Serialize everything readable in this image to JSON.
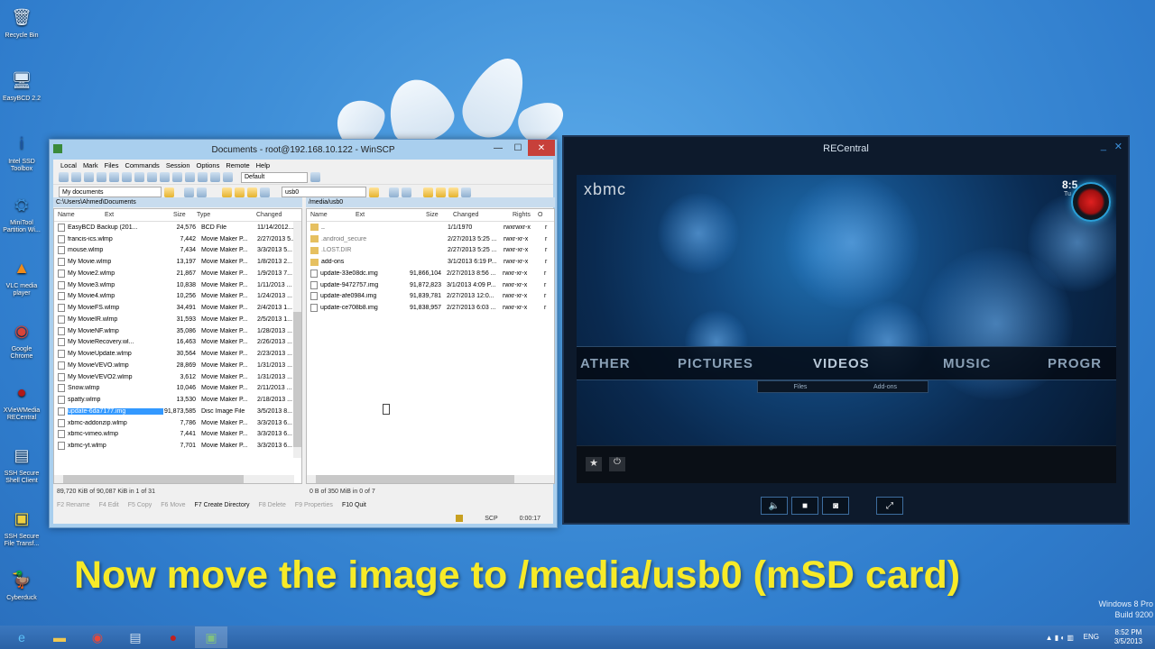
{
  "desktop": {
    "icons": [
      {
        "label": "Recycle Bin",
        "glyph": "🗑",
        "color": "#d8e8f8"
      },
      {
        "label": "EasyBCD 2.2",
        "glyph": "🖥",
        "color": "#d8e8f8"
      },
      {
        "label": "Intel SSD Toolbox",
        "glyph": "i",
        "color": "#1d57a8"
      },
      {
        "label": "MiniTool Partition Wi...",
        "glyph": "⛭",
        "color": "#3a8fd8"
      },
      {
        "label": "VLC media player",
        "glyph": "▲",
        "color": "#f08a1a"
      },
      {
        "label": "Google Chrome",
        "glyph": "◉",
        "color": "#d8443a"
      },
      {
        "label": "XVieWMedia RECentral",
        "glyph": "●",
        "color": "#b01818"
      },
      {
        "label": "SSH Secure Shell Client",
        "glyph": "▤",
        "color": "#d8e8f8"
      },
      {
        "label": "SSH Secure File Transf...",
        "glyph": "▣",
        "color": "#f0d040"
      },
      {
        "label": "Cyberduck",
        "glyph": "🦆",
        "color": "#f6c01e"
      }
    ],
    "watermark": {
      "line1": "Windows 8 Pro",
      "line2": "Build 9200"
    }
  },
  "winscp": {
    "title": "Documents - root@192.168.10.122 - WinSCP",
    "menu": [
      "Local",
      "Mark",
      "Files",
      "Commands",
      "Session",
      "Options",
      "Remote",
      "Help"
    ],
    "profile": "Default",
    "left": {
      "location": "My documents",
      "path": "C:\\Users\\Ahmed\\Documents",
      "columns": [
        "Name",
        "Ext",
        "Size",
        "Type",
        "Changed"
      ],
      "rows": [
        {
          "name": "EasyBCD Backup (201...",
          "size": "24,576",
          "type": "BCD File",
          "changed": "11/14/2012..."
        },
        {
          "name": "francis-ics.wlmp",
          "size": "7,442",
          "type": "Movie Maker P...",
          "changed": "2/27/2013 5..."
        },
        {
          "name": "mouse.wlmp",
          "size": "7,434",
          "type": "Movie Maker P...",
          "changed": "3/3/2013 5..."
        },
        {
          "name": "My Movie.wlmp",
          "size": "13,197",
          "type": "Movie Maker P...",
          "changed": "1/8/2013 2..."
        },
        {
          "name": "My Movie2.wlmp",
          "size": "21,867",
          "type": "Movie Maker P...",
          "changed": "1/9/2013 7..."
        },
        {
          "name": "My Movie3.wlmp",
          "size": "10,838",
          "type": "Movie Maker P...",
          "changed": "1/11/2013 ..."
        },
        {
          "name": "My Movie4.wlmp",
          "size": "10,256",
          "type": "Movie Maker P...",
          "changed": "1/24/2013 ..."
        },
        {
          "name": "My MovieFS.wlmp",
          "size": "34,491",
          "type": "Movie Maker P...",
          "changed": "2/4/2013 1..."
        },
        {
          "name": "My MovieIR.wlmp",
          "size": "31,593",
          "type": "Movie Maker P...",
          "changed": "2/5/2013 1..."
        },
        {
          "name": "My MovieNF.wlmp",
          "size": "35,086",
          "type": "Movie Maker P...",
          "changed": "1/28/2013 ..."
        },
        {
          "name": "My MovieRecovery.wl...",
          "size": "16,463",
          "type": "Movie Maker P...",
          "changed": "2/26/2013 ..."
        },
        {
          "name": "My MovieUpdate.wlmp",
          "size": "30,564",
          "type": "Movie Maker P...",
          "changed": "2/23/2013 ..."
        },
        {
          "name": "My MovieVEVO.wlmp",
          "size": "28,869",
          "type": "Movie Maker P...",
          "changed": "1/31/2013 ..."
        },
        {
          "name": "My MovieVEVO2.wlmp",
          "size": "3,612",
          "type": "Movie Maker P...",
          "changed": "1/31/2013 ..."
        },
        {
          "name": "Snow.wlmp",
          "size": "10,046",
          "type": "Movie Maker P...",
          "changed": "2/11/2013 ..."
        },
        {
          "name": "spatty.wlmp",
          "size": "13,530",
          "type": "Movie Maker P...",
          "changed": "2/18/2013 ..."
        },
        {
          "name": "update-6da7177.img",
          "size": "91,873,585",
          "type": "Disc Image File",
          "changed": "3/5/2013 8..."
        },
        {
          "name": "xbmc-addonzip.wlmp",
          "size": "7,786",
          "type": "Movie Maker P...",
          "changed": "3/3/2013 6..."
        },
        {
          "name": "xbmc-vimeo.wlmp",
          "size": "7,441",
          "type": "Movie Maker P...",
          "changed": "3/3/2013 6..."
        },
        {
          "name": "xbmc-yt.wlmp",
          "size": "7,701",
          "type": "Movie Maker P...",
          "changed": "3/3/2013 6..."
        }
      ],
      "selected_index": 16,
      "status": "89,720 KiB of 90,087 KiB in 1 of 31"
    },
    "right": {
      "location": "usb0",
      "path": "/media/usb0",
      "columns": [
        "Name",
        "Ext",
        "Size",
        "Changed",
        "Rights",
        "O"
      ],
      "rows": [
        {
          "name": "..",
          "size": "",
          "changed": "1/1/1970",
          "rights": "rwxrwxr-x",
          "o": "r",
          "folder": true
        },
        {
          "name": ".android_secure",
          "size": "",
          "changed": "2/27/2013 5:25 ...",
          "rights": "rwxr-xr-x",
          "o": "r",
          "folder": true
        },
        {
          "name": ".LOST.DIR",
          "size": "",
          "changed": "2/27/2013 5:25 ...",
          "rights": "rwxr-xr-x",
          "o": "r",
          "folder": true
        },
        {
          "name": "add-ons",
          "size": "",
          "changed": "3/1/2013 6:19 P...",
          "rights": "rwxr-xr-x",
          "o": "r",
          "folder": true
        },
        {
          "name": "update-33e08dc.img",
          "size": "91,866,104",
          "changed": "2/27/2013 8:56 ...",
          "rights": "rwxr-xr-x",
          "o": "r",
          "folder": false
        },
        {
          "name": "update-9472757.img",
          "size": "91,872,823",
          "changed": "3/1/2013 4:09 P...",
          "rights": "rwxr-xr-x",
          "o": "r",
          "folder": false
        },
        {
          "name": "update-afe0984.img",
          "size": "91,839,781",
          "changed": "2/27/2013 12:0...",
          "rights": "rwxr-xr-x",
          "o": "r",
          "folder": false
        },
        {
          "name": "update-ce708b8.img",
          "size": "91,838,957",
          "changed": "2/27/2013 6:03 ...",
          "rights": "rwxr-xr-x",
          "o": "r",
          "folder": false
        }
      ],
      "status": "0 B of 350 MiB in 0 of 7"
    },
    "fkeys": [
      "F2 Rename",
      "F4 Edit",
      "F5 Copy",
      "F6 Move",
      "F7 Create Directory",
      "F8 Delete",
      "F9 Properties",
      "F10 Quit"
    ],
    "fkeys_enabled": [
      false,
      false,
      false,
      false,
      true,
      false,
      false,
      true
    ],
    "bottom": {
      "protocol": "SCP",
      "time": "0:00:17"
    }
  },
  "recentral": {
    "title": "RECentral",
    "xbmc": {
      "logo": "xbmc",
      "time": "8:5",
      "day": "Tu",
      "menu": [
        "ATHER",
        "PICTURES",
        "VIDEOS",
        "MUSIC",
        "PROGR"
      ],
      "submenu": [
        "Files",
        "Add-ons"
      ]
    }
  },
  "caption": "Now move the image to /media/usb0 (mSD card)",
  "taskbar": {
    "lang": "ENG",
    "time": "8:52 PM",
    "date": "3/5/2013"
  }
}
